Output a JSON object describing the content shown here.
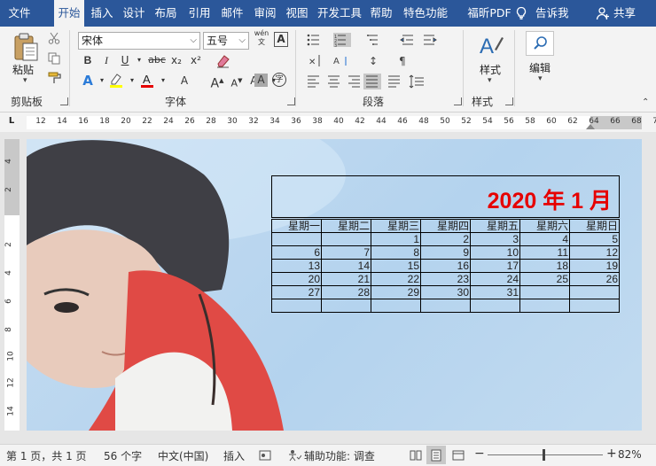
{
  "tabs": [
    "文件",
    "开始",
    "插入",
    "设计",
    "布局",
    "引用",
    "邮件",
    "审阅",
    "视图",
    "开发工具",
    "帮助",
    "特色功能",
    "福昕PDF",
    "告诉我",
    "共享"
  ],
  "ribbon": {
    "paste_label": "粘贴",
    "clipboard_group": "剪贴板",
    "font_name": "宋体",
    "font_size": "五号",
    "font_group": "字体",
    "paragraph_group": "段落",
    "styles_label": "样式",
    "styles_group": "样式",
    "edit_label": "编辑",
    "bold": "B",
    "italic": "I",
    "underline": "U",
    "strike": "abc",
    "sub": "x₂",
    "sup": "x²",
    "phonetic": "wén",
    "char_border": "A",
    "grow": "A",
    "shrink": "A",
    "case": "Aa",
    "shade": "A",
    "enclose": "字"
  },
  "ruler": {
    "horizontal": [
      "12",
      "14",
      "16",
      "18",
      "20",
      "22",
      "24",
      "26",
      "28",
      "30",
      "32",
      "34",
      "36",
      "38",
      "40",
      "42",
      "44",
      "46",
      "48",
      "50",
      "52",
      "54",
      "56",
      "58",
      "60",
      "62",
      "64",
      "66",
      "68",
      "70"
    ],
    "vertical": [
      "4",
      "2",
      "2",
      "4",
      "6",
      "8",
      "10",
      "12",
      "14"
    ],
    "corner": "L"
  },
  "calendar": {
    "title": "2020 年 1 月",
    "title_color": "#e60000",
    "headers": [
      "星期一",
      "星期二",
      "星期三",
      "星期四",
      "星期五",
      "星期六",
      "星期日"
    ],
    "rows": [
      [
        "",
        "",
        "1",
        "2",
        "3",
        "4",
        "5"
      ],
      [
        "6",
        "7",
        "8",
        "9",
        "10",
        "11",
        "12"
      ],
      [
        "13",
        "14",
        "15",
        "16",
        "17",
        "18",
        "19"
      ],
      [
        "20",
        "21",
        "22",
        "23",
        "24",
        "25",
        "26"
      ],
      [
        "27",
        "28",
        "29",
        "30",
        "31",
        "",
        ""
      ],
      [
        "",
        "",
        "",
        "",
        "",
        "",
        ""
      ]
    ]
  },
  "status": {
    "page": "第 1 页，共 1 页",
    "words": "56 个字",
    "lang": "中文(中国)",
    "mode": "插入",
    "accessibility": "辅助功能: 调查",
    "zoom": "82%",
    "minus": "−",
    "plus": "+"
  },
  "colors": {
    "accent": "#2b579a",
    "highlight": "#ffff00",
    "font_color": "#e60000"
  }
}
